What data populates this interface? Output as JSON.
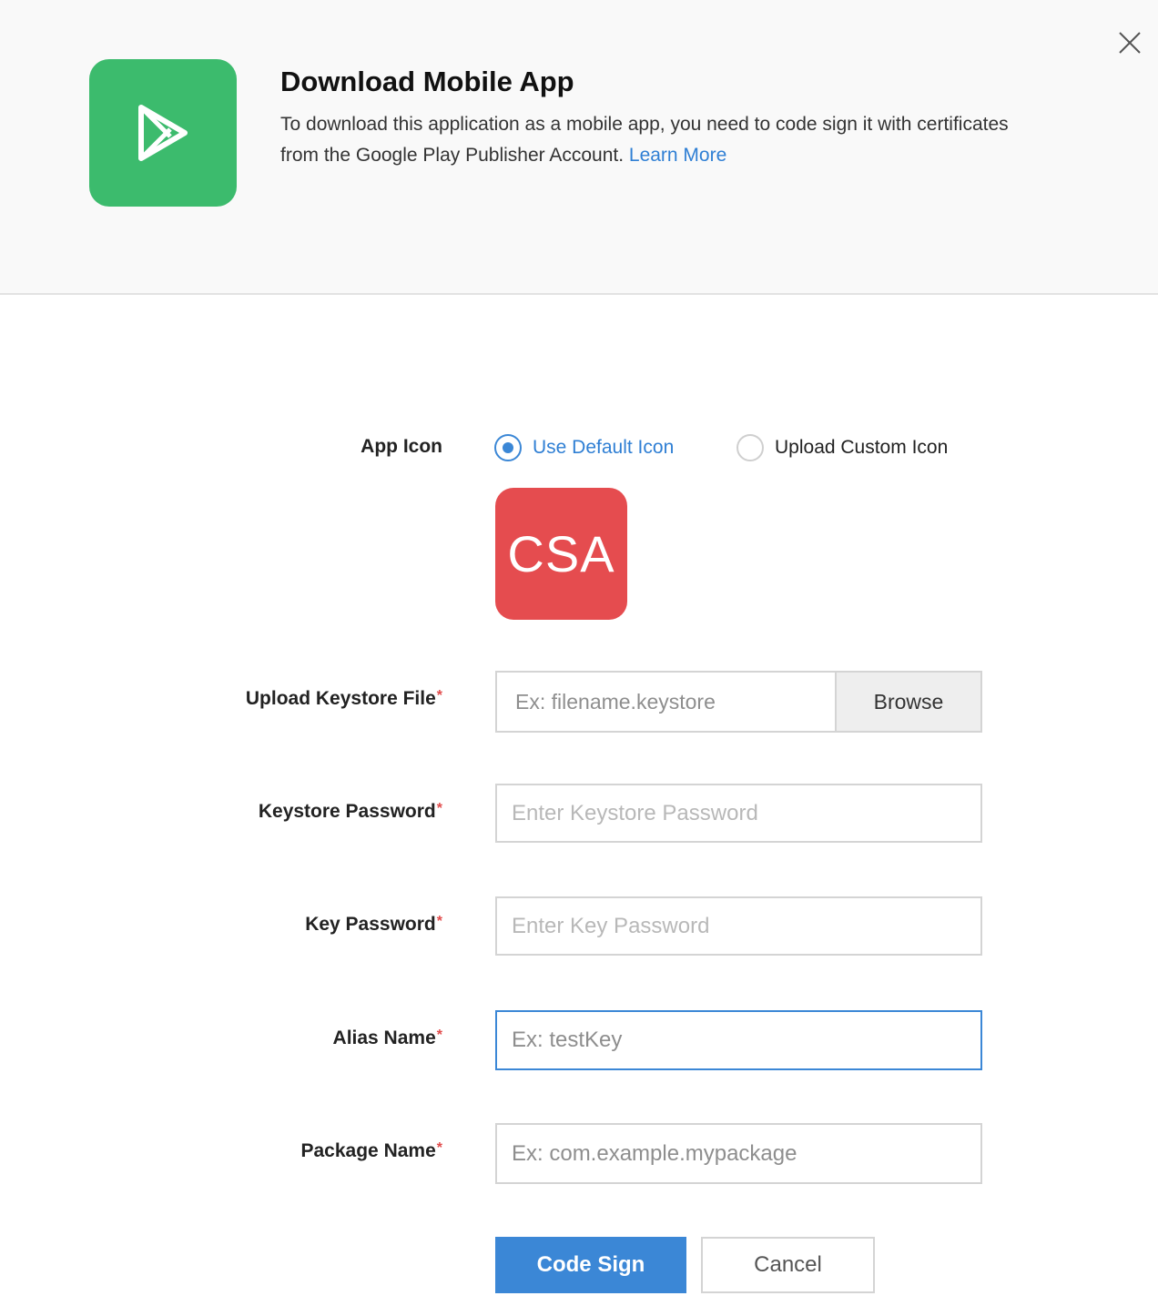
{
  "header": {
    "title": "Download Mobile App",
    "description": "To download this application as a mobile app, you need to code sign it with certificates from the Google Play Publisher Account.",
    "learn_more": "Learn More",
    "logo_icon": "google-play-icon",
    "close_icon": "close-icon"
  },
  "app_icon": {
    "label": "App Icon",
    "options": [
      {
        "label": "Use Default Icon",
        "selected": true
      },
      {
        "label": "Upload Custom Icon",
        "selected": false
      }
    ],
    "default_icon_text": "CSA",
    "default_icon_color": "#e54c4f"
  },
  "form": {
    "keystore_file": {
      "label": "Upload Keystore File",
      "placeholder": "Ex: filename.keystore",
      "browse": "Browse"
    },
    "keystore_password": {
      "label": "Keystore Password",
      "placeholder": "Enter Keystore Password"
    },
    "key_password": {
      "label": "Key Password",
      "placeholder": "Enter Key Password"
    },
    "alias_name": {
      "label": "Alias Name",
      "placeholder": "Ex: testKey"
    },
    "package_name": {
      "label": "Package Name",
      "placeholder": "Ex: com.example.mypackage"
    },
    "required_mark": "*"
  },
  "actions": {
    "submit": "Code Sign",
    "cancel": "Cancel"
  },
  "colors": {
    "accent": "#3b87d6",
    "logo_green": "#3cbb6d",
    "required": "#e14b4b"
  }
}
